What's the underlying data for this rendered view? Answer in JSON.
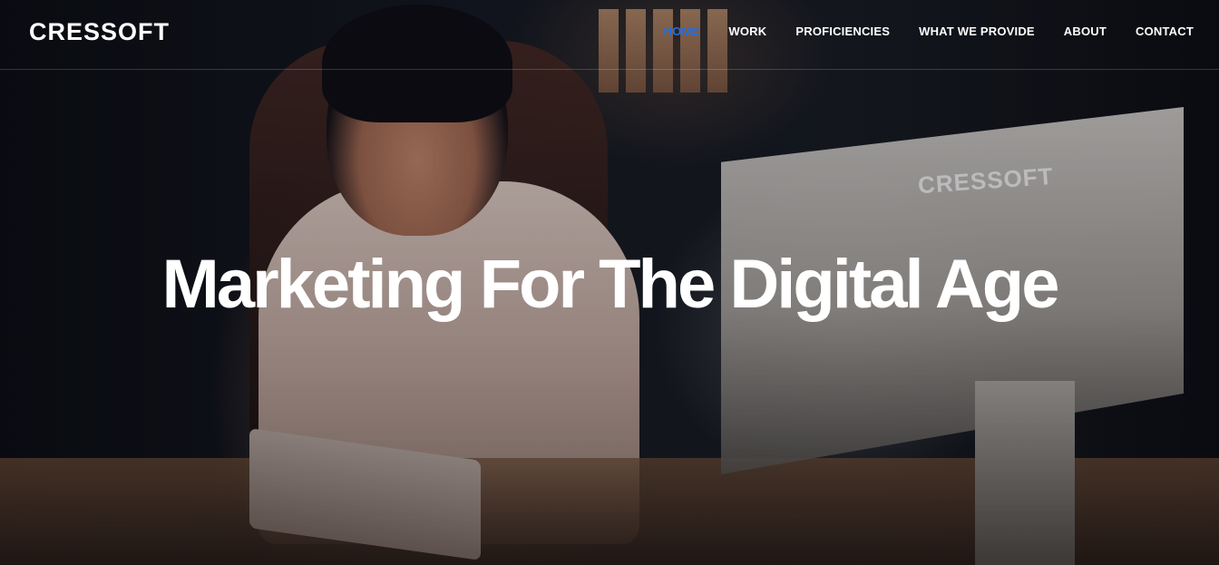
{
  "brand": {
    "logo_text": "CRESSOFT",
    "monitor_logo_text": "CRESSOFT"
  },
  "nav": {
    "items": [
      {
        "label": "HOME",
        "active": true
      },
      {
        "label": "WORK",
        "active": false
      },
      {
        "label": "PROFICIENCIES",
        "active": false
      },
      {
        "label": "WHAT WE PROVIDE",
        "active": false
      },
      {
        "label": "ABOUT",
        "active": false
      },
      {
        "label": "CONTACT",
        "active": false
      }
    ],
    "active_color": "#1e6fe6"
  },
  "hero": {
    "headline": "Marketing For The Digital Age"
  },
  "colors": {
    "text": "#ffffff",
    "background": "#101218"
  }
}
